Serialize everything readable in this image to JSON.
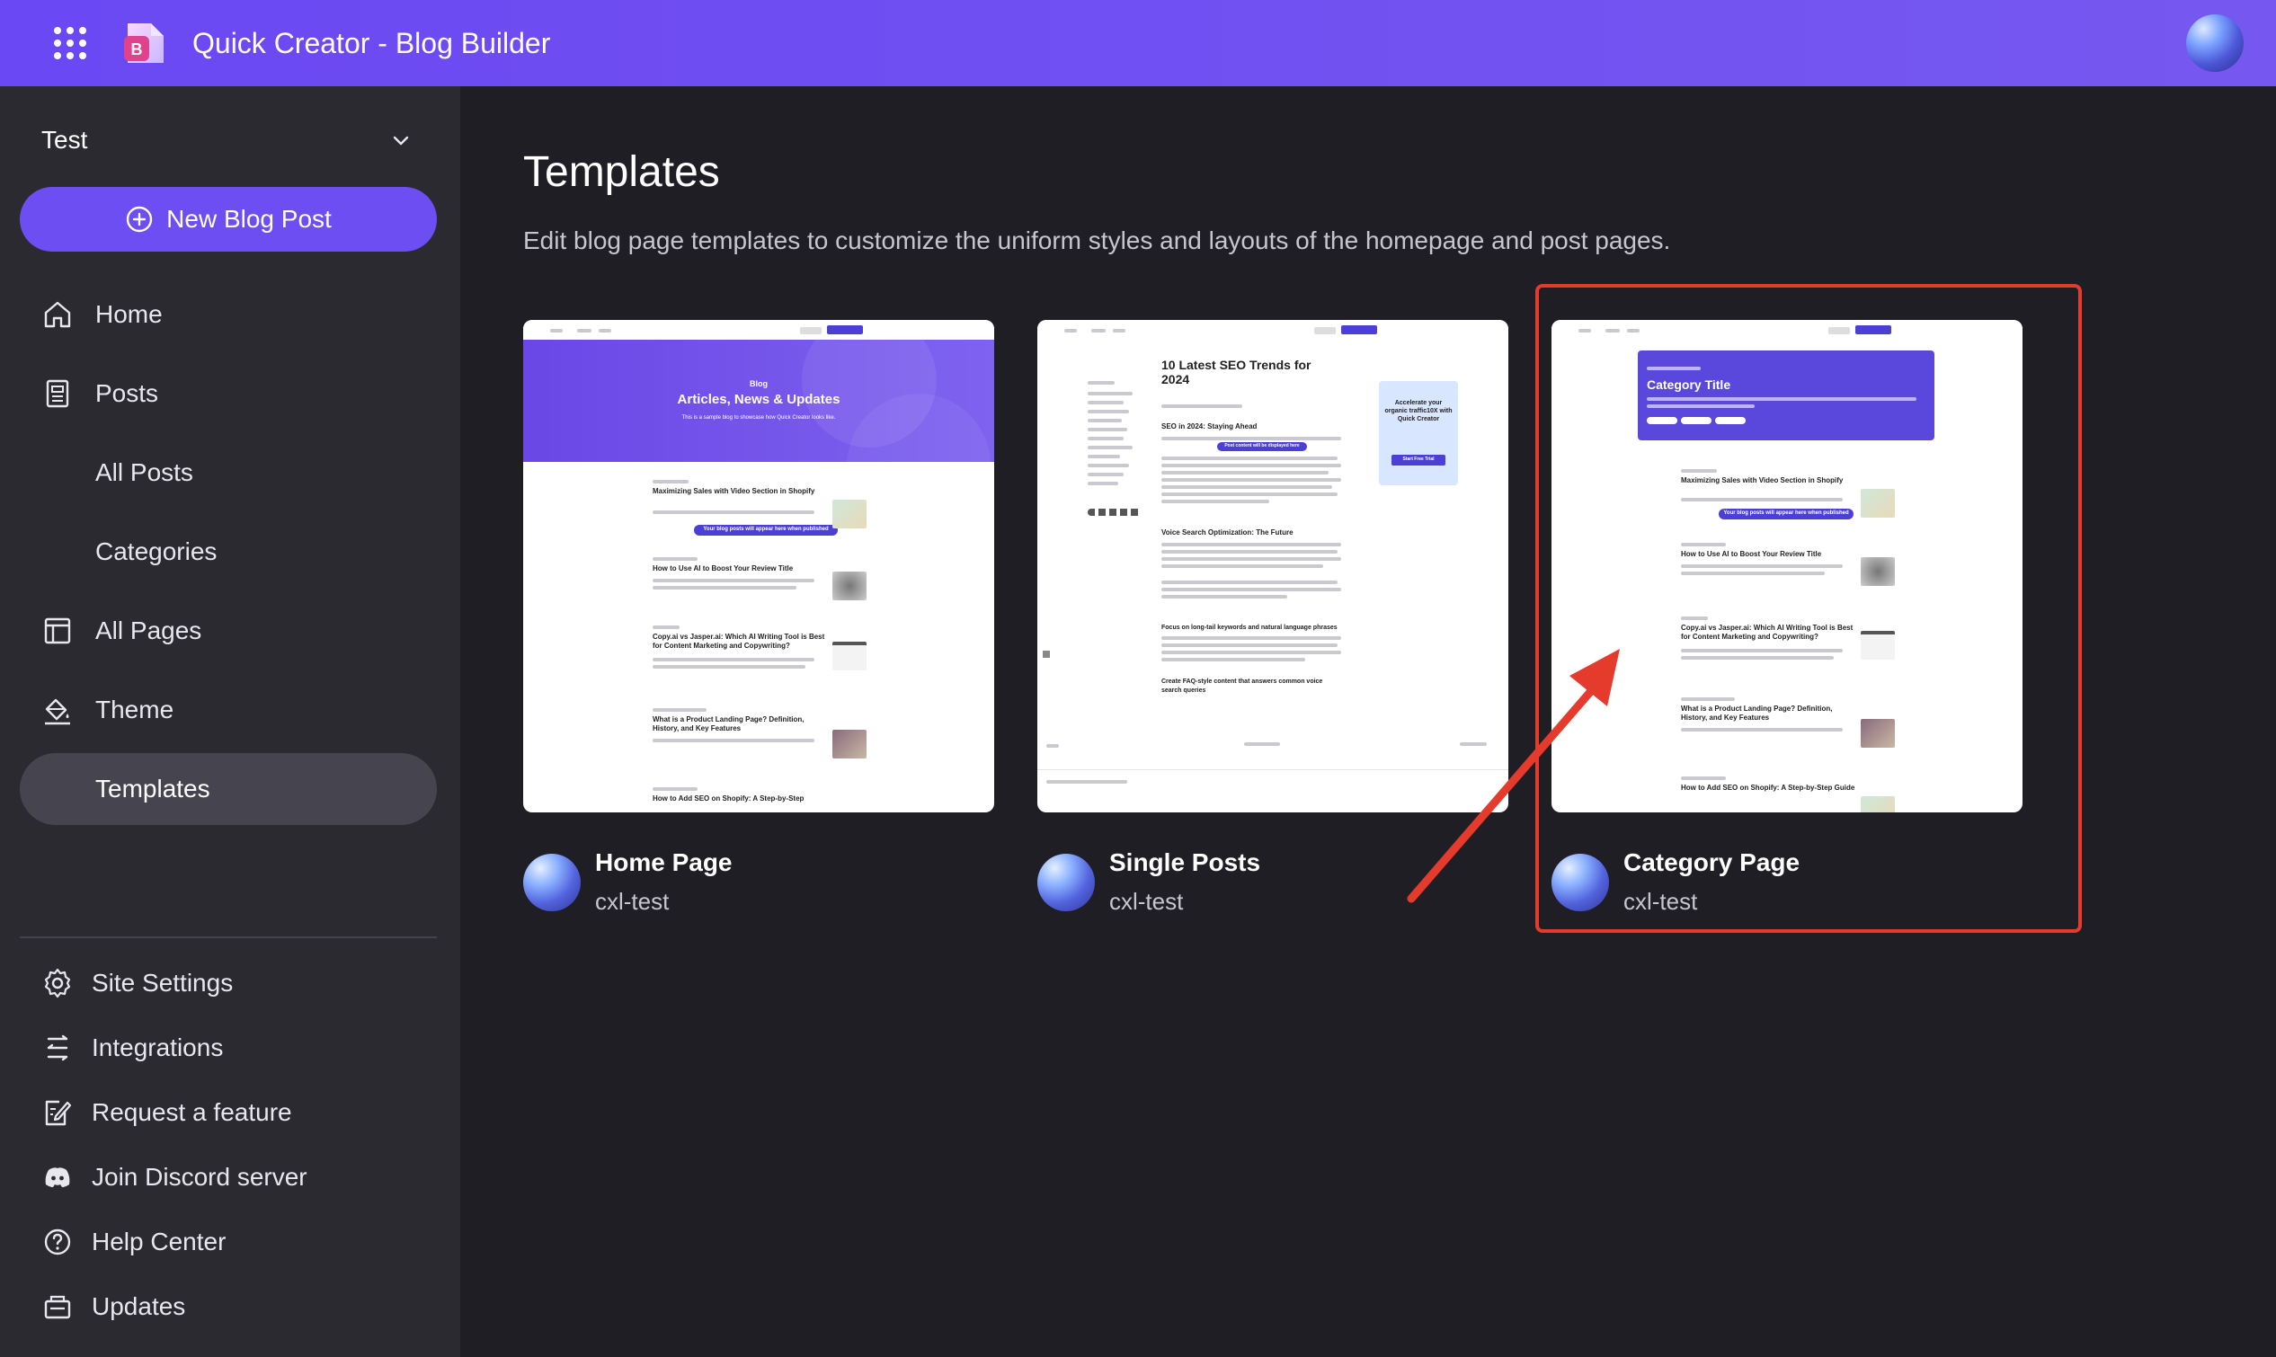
{
  "app": {
    "title": "Quick Creator - Blog Builder",
    "logo_letter": "B"
  },
  "sidebar": {
    "workspace": "Test",
    "new_post_label": "New Blog Post",
    "items": [
      {
        "label": "Home",
        "icon": "home-icon"
      },
      {
        "label": "Posts",
        "icon": "document-icon"
      },
      {
        "label": "All Posts",
        "icon": ""
      },
      {
        "label": "Categories",
        "icon": ""
      },
      {
        "label": "All Pages",
        "icon": "layout-icon"
      },
      {
        "label": "Theme",
        "icon": "paint-bucket-icon"
      },
      {
        "label": "Templates",
        "icon": "",
        "active": true
      }
    ],
    "bottom_items": [
      {
        "label": "Site Settings",
        "icon": "gear-icon"
      },
      {
        "label": "Integrations",
        "icon": "integrations-icon"
      },
      {
        "label": "Request a feature",
        "icon": "edit-icon"
      },
      {
        "label": "Join Discord server",
        "icon": "discord-icon"
      },
      {
        "label": "Help Center",
        "icon": "help-icon"
      },
      {
        "label": "Updates",
        "icon": "updates-icon"
      }
    ]
  },
  "main": {
    "title": "Templates",
    "description": "Edit blog page templates to customize the uniform styles and layouts of the homepage and post pages.",
    "templates": [
      {
        "name": "Home Page",
        "owner": "cxl-test",
        "preview": {
          "hero_small": "Blog",
          "hero_title": "Articles, News & Updates",
          "hero_sub": "This is a sample blog to showcase how Quick Creator looks like.",
          "tooltip": "Your blog posts will appear here when published",
          "posts": [
            "Maximizing Sales with Video Section in Shopify",
            "How to Use AI to Boost Your Review Title",
            "Copy.ai vs Jasper.ai: Which AI Writing Tool is Best for Content Marketing and Copywriting?",
            "What is a Product Landing Page? Definition, History, and Key Features",
            "How to Add SEO on Shopify: A Step-by-Step"
          ]
        }
      },
      {
        "name": "Single Posts",
        "owner": "cxl-test",
        "preview": {
          "post_title": "10 Latest SEO Trends for 2024",
          "h1": "SEO in 2024: Staying Ahead",
          "h2": "Voice Search Optimization: The Future",
          "h3": "Focus on long-tail keywords and natural language phrases",
          "h4": "Create FAQ-style content that answers common voice search queries",
          "tooltip": "Post content will be displayed here",
          "cta": "Accelerate your organic traffic10X with Quick Creator",
          "cta_btn": "Start Free Trial"
        }
      },
      {
        "name": "Category Page",
        "owner": "cxl-test",
        "preview": {
          "hero_title": "Category Title",
          "tooltip": "Your blog posts will appear here when published",
          "posts": [
            "Maximizing Sales with Video Section in Shopify",
            "How to Use AI to Boost Your Review Title",
            "Copy.ai vs Jasper.ai: Which AI Writing Tool is Best for Content Marketing and Copywriting?",
            "What is a Product Landing Page? Definition, History, and Key Features",
            "How to Add SEO on Shopify: A Step-by-Step Guide"
          ]
        }
      }
    ]
  },
  "colors": {
    "accent": "#6c4ef2",
    "topbar": "#6a48f3",
    "highlight": "#e53b2c",
    "sidebar": "#2b2a31",
    "background": "#1f1e25"
  }
}
